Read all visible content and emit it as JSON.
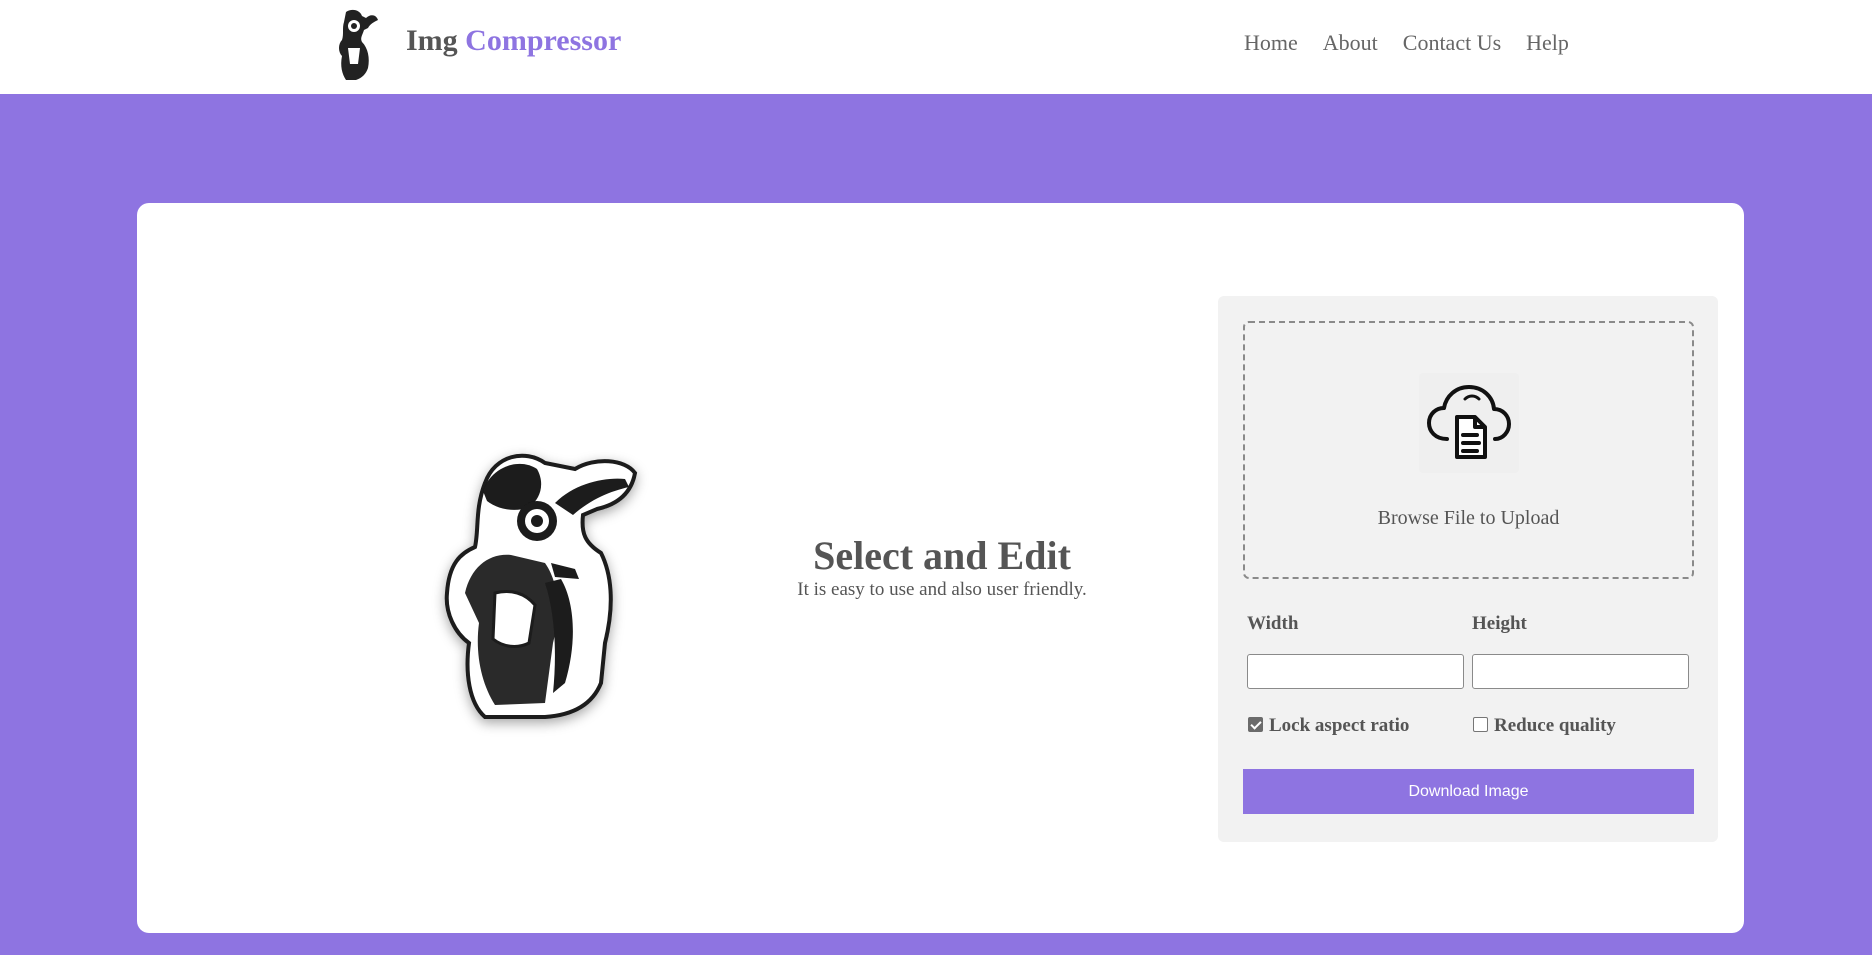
{
  "brand": {
    "prefix": "Img",
    "accent": "Compressor",
    "accent_color": "#8e74e1",
    "logo_icon": "photographer-logo"
  },
  "nav": {
    "items": [
      {
        "label": "Home"
      },
      {
        "label": "About"
      },
      {
        "label": "Contact Us"
      },
      {
        "label": "Help"
      }
    ]
  },
  "hero": {
    "illustration": "photographer-illustration",
    "title": "Select and Edit",
    "subtitle": "It is easy to use and also user friendly."
  },
  "upload": {
    "icon": "cloud-document-icon",
    "label": "Browse File to Upload",
    "width_label": "Width",
    "height_label": "Height",
    "width_value": "",
    "height_value": "",
    "lock_aspect": {
      "label": "Lock aspect ratio",
      "checked": true
    },
    "reduce_quality": {
      "label": "Reduce quality",
      "checked": false
    },
    "download_label": "Download Image"
  },
  "colors": {
    "background": "#8e74e1",
    "card": "#ffffff",
    "panel": "#f2f2f2",
    "text": "#555555"
  }
}
